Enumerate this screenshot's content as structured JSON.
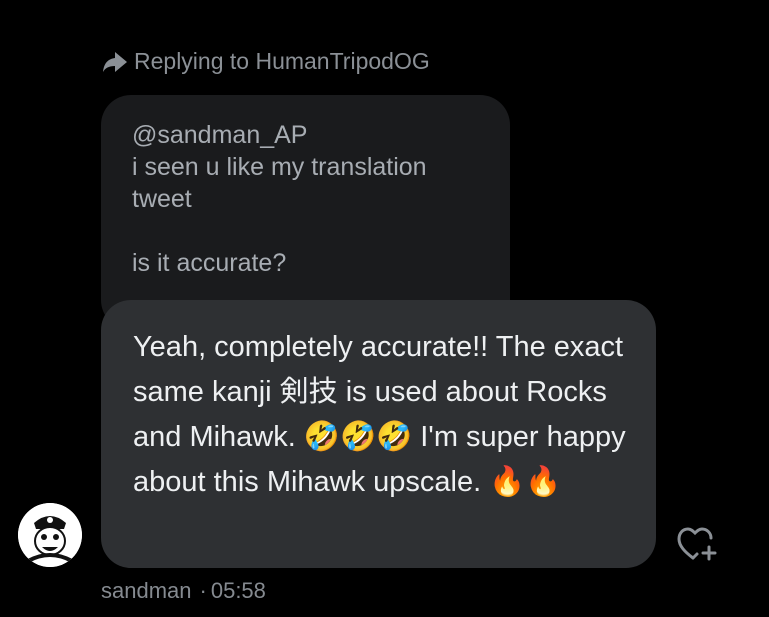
{
  "reply_context": {
    "icon": "reply-arrow-icon",
    "label": "Replying to HumanTripodOG"
  },
  "quoted_message": {
    "text": "@sandman_AP\ni seen u like my translation tweet\n\nis it accurate?"
  },
  "message": {
    "text": "Yeah, completely accurate!! The exact same kanji 剣技 is used about Rocks and Mihawk. 🤣🤣🤣     I'm super happy about this Mihawk upscale. 🔥🔥",
    "reaction_icon": "heart-plus-icon"
  },
  "sender": {
    "avatar_icon": "avatar",
    "name": "sandman",
    "separator": "·",
    "time": "05:58"
  },
  "colors": {
    "background": "#000000",
    "quoted_bubble": "#1a1b1d",
    "message_bubble": "#2e3033",
    "muted_text": "#8b9096"
  }
}
